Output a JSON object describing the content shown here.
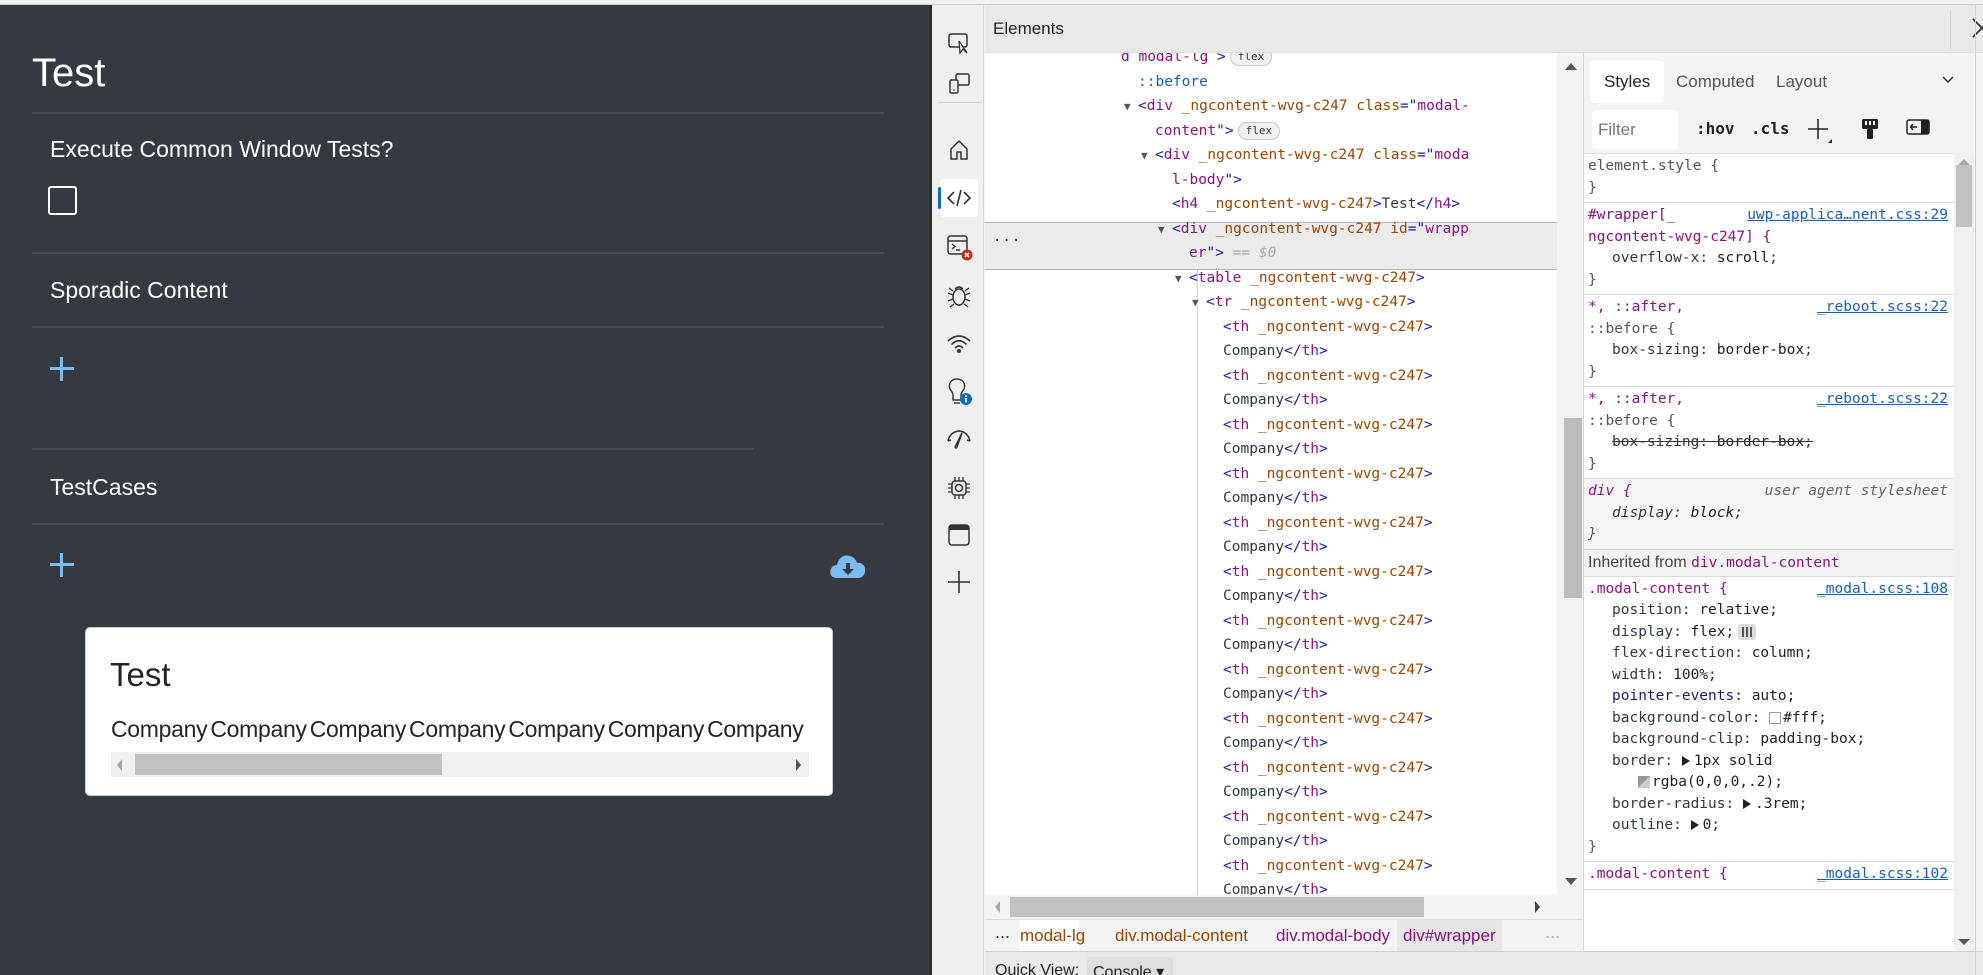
{
  "app": {
    "title": "Test",
    "sections": [
      {
        "label": "Execute Common Window Tests?",
        "checkbox_checked": false
      },
      {
        "label": "Sporadic Content",
        "add_icon": "plus-icon"
      },
      {
        "label": "TestCases",
        "add_icon": "plus-icon",
        "download_icon": "cloud-download-icon"
      }
    ],
    "accent_color": "#7bbcf5",
    "background_color": "#343a40",
    "modal": {
      "title": "Test",
      "table_headers": [
        "Company",
        "Company",
        "Company",
        "Company",
        "Company",
        "Company",
        "Company"
      ],
      "scroll_position_fraction": 0.0
    }
  },
  "devtools": {
    "panel_title": "Elements",
    "close_icon": "close-icon",
    "activity_bar": [
      {
        "name": "inspect-element-icon"
      },
      {
        "name": "device-emulation-icon"
      },
      {
        "name": "welcome-home-icon"
      },
      {
        "name": "elements-icon",
        "selected": true
      },
      {
        "name": "console-icon",
        "badge": "error"
      },
      {
        "name": "sources-bug-icon"
      },
      {
        "name": "network-icon"
      },
      {
        "name": "issues-icon",
        "badge": "info"
      },
      {
        "name": "performance-icon"
      },
      {
        "name": "memory-icon"
      },
      {
        "name": "application-icon"
      },
      {
        "name": "more-tools-plus-icon"
      }
    ],
    "dom_tree": [
      {
        "indent": 0,
        "parts": [
          [
            "val",
            "d modal-lg "
          ],
          [
            "bracket",
            ">"
          ]
        ],
        "badge": "flex"
      },
      {
        "indent": 1,
        "parts": [
          [
            "pseudo",
            "::before"
          ]
        ]
      },
      {
        "indent": 1,
        "tri": true,
        "parts": [
          [
            "bracket",
            "<"
          ],
          [
            "tag",
            "div"
          ],
          [
            "attr",
            " _ngcontent-wvg-c247"
          ],
          [
            "attr",
            " class"
          ],
          [
            "bracket",
            "=\""
          ],
          [
            "val",
            "modal-"
          ]
        ]
      },
      {
        "indent": 2,
        "parts": [
          [
            "val",
            "content"
          ],
          [
            "bracket",
            "\">"
          ]
        ],
        "badge": "flex"
      },
      {
        "indent": 2,
        "tri": true,
        "parts": [
          [
            "bracket",
            "<"
          ],
          [
            "tag",
            "div"
          ],
          [
            "attr",
            " _ngcontent-wvg-c247"
          ],
          [
            "attr",
            " class"
          ],
          [
            "bracket",
            "=\""
          ],
          [
            "val",
            "moda"
          ]
        ]
      },
      {
        "indent": 3,
        "parts": [
          [
            "val",
            "l-body"
          ],
          [
            "bracket",
            "\">"
          ]
        ]
      },
      {
        "indent": 3,
        "parts": [
          [
            "bracket",
            "<"
          ],
          [
            "tag",
            "h4"
          ],
          [
            "attr",
            " _ngcontent-wvg-c247"
          ],
          [
            "bracket",
            ">"
          ],
          [
            "txt",
            "Test"
          ],
          [
            "bracket",
            "</"
          ],
          [
            "tag",
            "h4"
          ],
          [
            "bracket",
            ">"
          ]
        ]
      },
      {
        "indent": 3,
        "tri": true,
        "selected": true,
        "parts": [
          [
            "bracket",
            "<"
          ],
          [
            "tag",
            "div"
          ],
          [
            "attr",
            " _ngcontent-wvg-c247"
          ],
          [
            "attr",
            " id"
          ],
          [
            "bracket",
            "=\""
          ],
          [
            "val",
            "wrapp"
          ]
        ]
      },
      {
        "indent": 4,
        "parts": [
          [
            "val",
            "er"
          ],
          [
            "bracket",
            "\">"
          ],
          [
            "dim",
            " == $0"
          ]
        ]
      },
      {
        "indent": 4,
        "tri": true,
        "parts": [
          [
            "bracket",
            "<"
          ],
          [
            "tag",
            "table"
          ],
          [
            "attr",
            " _ngcontent-wvg-c247"
          ],
          [
            "bracket",
            ">"
          ]
        ]
      },
      {
        "indent": 5,
        "tri": true,
        "parts": [
          [
            "bracket",
            "<"
          ],
          [
            "tag",
            "tr"
          ],
          [
            "attr",
            " _ngcontent-wvg-c247"
          ],
          [
            "bracket",
            ">"
          ]
        ]
      }
    ],
    "th_open": " _ngcontent-wvg-c247",
    "th_text": "Company",
    "th_count_visible": 12,
    "selected_suffix": "== $0",
    "more_dots": "...",
    "breadcrumbs": [
      "modal-lg",
      "div.modal-content",
      "div.modal-body",
      "div#wrapper"
    ],
    "breadcrumb_selected": "div#wrapper",
    "quick_view": {
      "label": "Quick View:",
      "tab": "Console"
    },
    "styles_pane": {
      "tabs": [
        "Styles",
        "Computed",
        "Layout"
      ],
      "active_tab": "Styles",
      "filter_placeholder": "Filter",
      "hov_label": ":hov",
      "cls_label": ".cls",
      "rules": [
        {
          "selector": "element.style {",
          "source": "",
          "props": [],
          "close": "}"
        },
        {
          "selector": "#wrapper[_",
          "selector2": "ngcontent-wvg-c247] {",
          "source": "uwp-applica…nent.css:29",
          "props": [
            {
              "name": "overflow-x",
              "value": "scroll"
            }
          ],
          "close": "}"
        },
        {
          "selector": "*, ::after,",
          "selector2": "::before {",
          "source": "_reboot.scss:22",
          "props": [
            {
              "name": "box-sizing",
              "value": "border-box"
            }
          ],
          "close": "}"
        },
        {
          "selector": "*, ::after,",
          "selector2": "::before {",
          "source": "_reboot.scss:22",
          "props": [
            {
              "name": "box-sizing",
              "value": "border-box",
              "struck": true
            }
          ],
          "close": "}"
        },
        {
          "selector": "div {",
          "source": "user agent stylesheet",
          "ua": true,
          "props": [
            {
              "name": "display",
              "value": "block"
            }
          ],
          "close": "}"
        }
      ],
      "inherited_label": "Inherited from",
      "inherited_from": "div.modal-content",
      "modal_rule": {
        "selector": ".modal-content {",
        "source": "_modal.scss:108",
        "props": [
          {
            "name": "position",
            "value": "relative;"
          },
          {
            "name": "display",
            "value": "flex;"
          },
          {
            "name": "flex-direction",
            "value": "column;"
          },
          {
            "name": "width",
            "value": "100%;"
          },
          {
            "name": "pointer-events",
            "value": "auto;"
          },
          {
            "name": "background-color",
            "value": "#fff;"
          },
          {
            "name": "background-clip",
            "value": "padding-box;"
          },
          {
            "name": "border",
            "value": "1px solid"
          },
          {
            "name": "",
            "value": "rgba(0,0,0,.2);"
          },
          {
            "name": "border-radius",
            "value": ".3rem;"
          },
          {
            "name": "outline",
            "value": "0;"
          }
        ],
        "close": "}"
      },
      "next_rule": {
        "selector": ".modal-content {",
        "source": "_modal.scss:102"
      }
    }
  }
}
